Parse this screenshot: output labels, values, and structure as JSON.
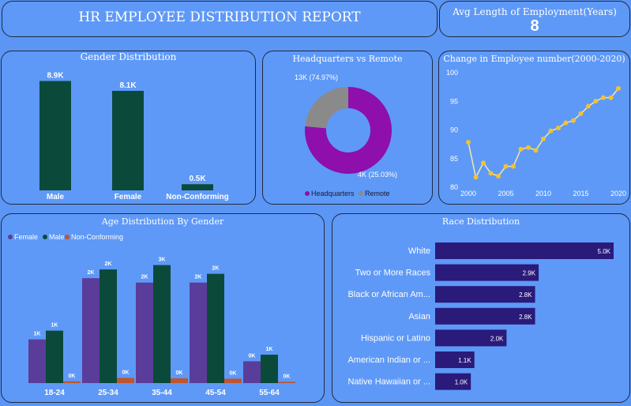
{
  "header": {
    "title": "HR EMPLOYEE DISTRIBUTION REPORT",
    "kpi_label": "Avg Length of Employment(Years)",
    "kpi_value": "8"
  },
  "colors": {
    "background": "#5b96f5",
    "male": "#0b4a3a",
    "female": "#5a3d9a",
    "nonconforming": "#c0552e",
    "headquarters": "#8e0fab",
    "remote": "#8a8a8a",
    "line": "#f2c230",
    "race_bar": "#2a1a7a"
  },
  "chart_data": [
    {
      "id": "gender",
      "type": "bar",
      "title": "Gender Distribution",
      "categories": [
        "Male",
        "Female",
        "Non-Conforming"
      ],
      "values": [
        8900,
        8100,
        500
      ],
      "data_labels": [
        "8.9K",
        "8.1K",
        "0.5K"
      ],
      "ylim": [
        0,
        9000
      ]
    },
    {
      "id": "hq",
      "type": "pie",
      "title": "Headquarters vs Remote",
      "categories": [
        "Headquarters",
        "Remote"
      ],
      "values": [
        13000,
        4000
      ],
      "percents": [
        74.97,
        25.03
      ],
      "data_labels": [
        "13K (74.97%)",
        "4K (25.03%)"
      ]
    },
    {
      "id": "trend",
      "type": "line",
      "title": "Change in Employee number(2000-2020)",
      "x": [
        2000,
        2001,
        2002,
        2003,
        2004,
        2005,
        2006,
        2007,
        2008,
        2009,
        2010,
        2011,
        2012,
        2013,
        2014,
        2015,
        2016,
        2017,
        2018,
        2019,
        2020
      ],
      "values": [
        87.7,
        81.6,
        84.1,
        82.3,
        81.8,
        83.5,
        83.5,
        86.5,
        86.8,
        86.3,
        88.3,
        89.7,
        90.2,
        91.1,
        91.5,
        92.7,
        94.0,
        94.9,
        95.5,
        95.5,
        97.1
      ],
      "x_ticks": [
        2000,
        2005,
        2010,
        2015,
        2020
      ],
      "y_ticks": [
        80,
        85,
        90,
        95,
        100
      ],
      "ylim": [
        80,
        100
      ],
      "xlim": [
        2000,
        2020
      ]
    },
    {
      "id": "age",
      "type": "bar",
      "title": "Age Distribution By Gender",
      "categories": [
        "18-24",
        "25-34",
        "35-44",
        "45-54",
        "55-64"
      ],
      "legend": [
        "Female",
        "Male",
        "Non-Conforming"
      ],
      "series": [
        {
          "name": "Female",
          "values": [
            1000,
            2400,
            2300,
            2300,
            500
          ],
          "data_labels": [
            "1K",
            "2K",
            "2K",
            "2K",
            "0K"
          ]
        },
        {
          "name": "Male",
          "values": [
            1200,
            2600,
            2700,
            2500,
            650
          ],
          "data_labels": [
            "1K",
            "2K",
            "3K",
            "2K",
            "1K"
          ]
        },
        {
          "name": "Non-Conforming",
          "values": [
            40,
            120,
            110,
            100,
            30
          ],
          "data_labels": [
            "0K",
            "0K",
            "0K",
            "0K",
            "0K"
          ]
        }
      ],
      "ylim": [
        0,
        3000
      ]
    },
    {
      "id": "race",
      "type": "bar",
      "orientation": "horizontal",
      "title": "Race Distribution",
      "categories": [
        "White",
        "Two or More Races",
        "Black or African Am...",
        "Asian",
        "Hispanic or Latino",
        "American Indian or ...",
        "Native Hawaiian or ..."
      ],
      "values": [
        5000,
        2900,
        2800,
        2800,
        2000,
        1100,
        1000
      ],
      "data_labels": [
        "5.0K",
        "2.9K",
        "2.8K",
        "2.8K",
        "2.0K",
        "1.1K",
        "1.0K"
      ],
      "xlim": [
        0,
        5000
      ]
    }
  ]
}
